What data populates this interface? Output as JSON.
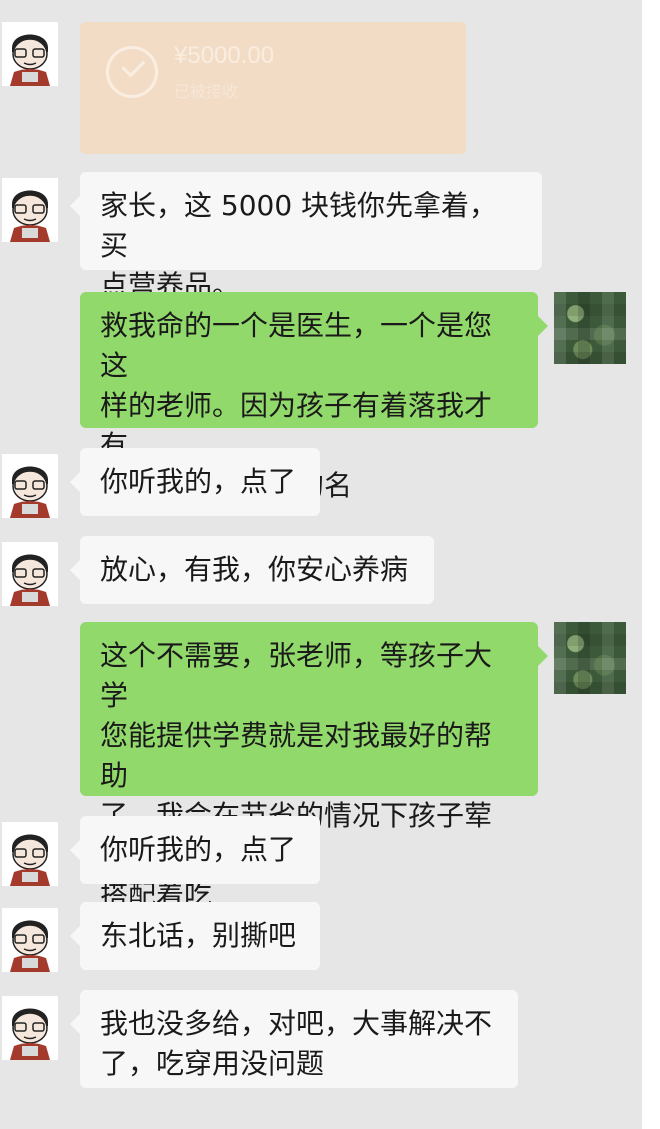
{
  "transfer": {
    "amount": "¥5000.00",
    "status": "已被接收"
  },
  "messages": [
    {
      "side": "left",
      "text": "家长，这 5000 块钱你先拿着，买\n点营养品。"
    },
    {
      "side": "right",
      "text": "救我命的一个是医生，一个是您这\n样的老师。因为孩子有着落我才有\n信心。您救来我的名"
    },
    {
      "side": "left",
      "text": "你听我的，点了"
    },
    {
      "side": "left",
      "text": "放心，有我，你安心养病"
    },
    {
      "side": "right",
      "text": "这个不需要，张老师，等孩子大学\n您能提供学费就是对我最好的帮助\n了。我会在节省的情况下孩子荤素\n搭配着吃"
    },
    {
      "side": "left",
      "text": "你听我的，点了"
    },
    {
      "side": "left",
      "text": "东北话，别撕吧"
    },
    {
      "side": "left",
      "text": "我也没多给，对吧，大事解决不\n了，吃穿用没问题"
    }
  ],
  "icons": {
    "teacher_avatar": "cartoon-avatar-icon",
    "parent_avatar": "pixelated-avatar-icon"
  },
  "colors": {
    "sent_bubble": "#92d96b",
    "received_bubble": "#f7f7f7",
    "transfer_card": "#f3dcc6",
    "background": "#e6e6e6"
  }
}
